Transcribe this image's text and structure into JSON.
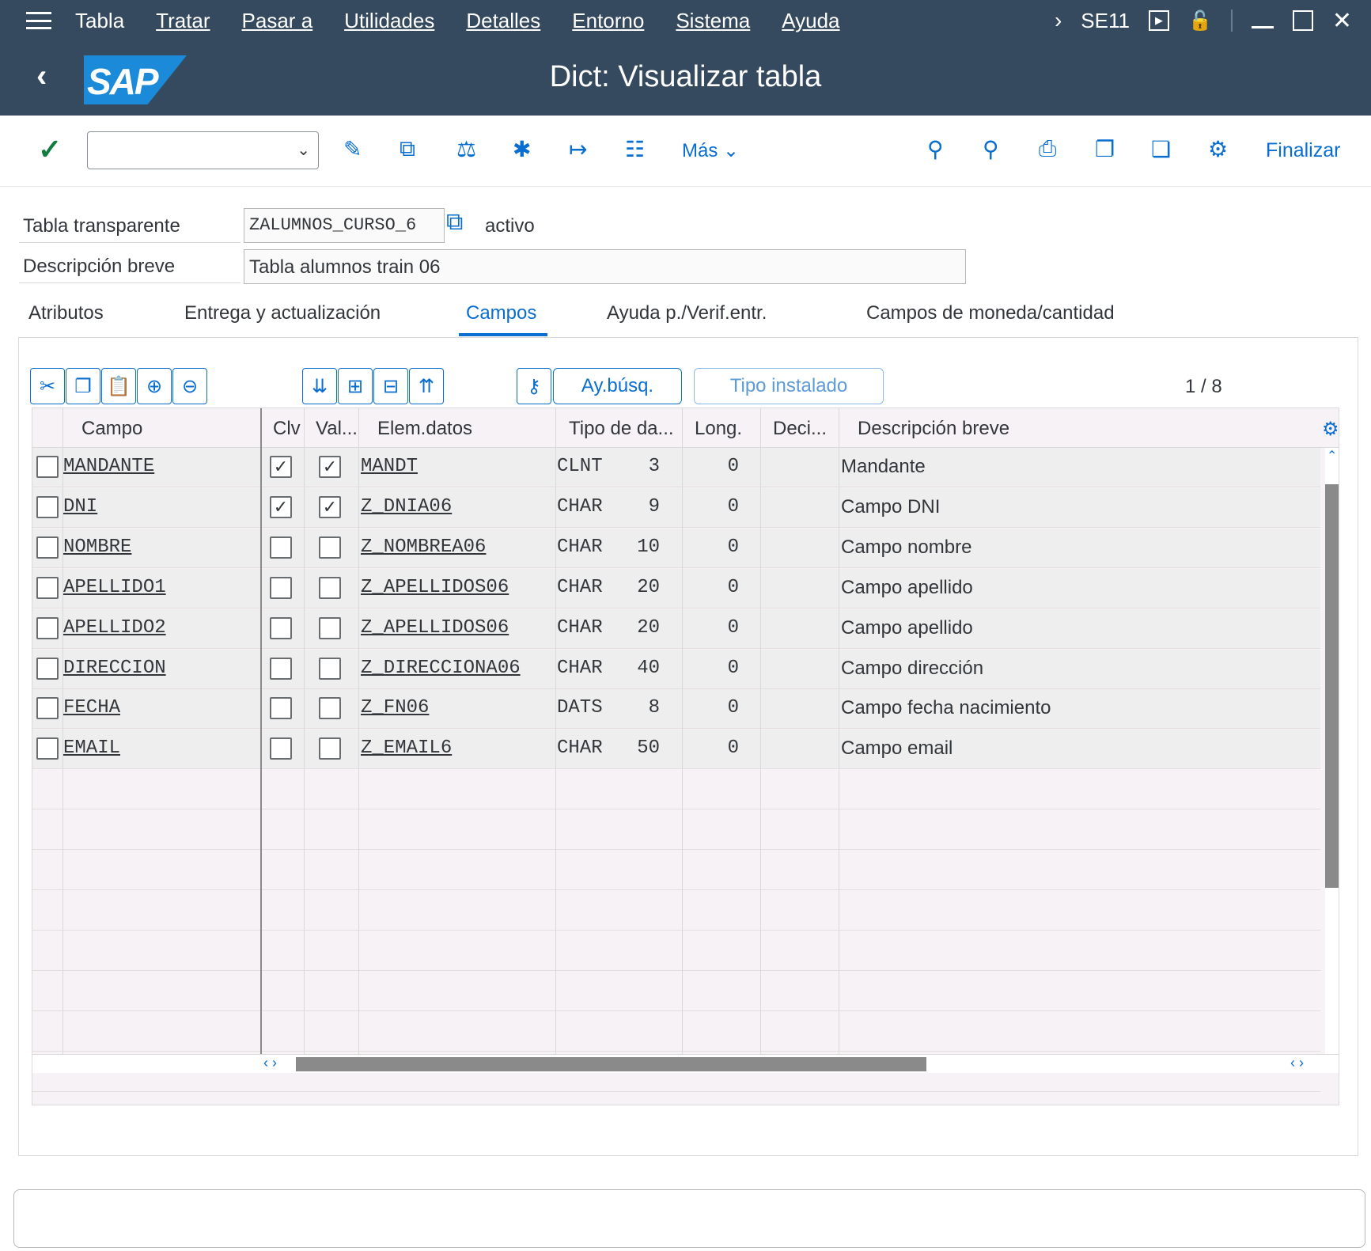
{
  "menu": {
    "items": [
      "Tabla",
      "Tratar",
      "Pasar a",
      "Utilidades",
      "Detalles",
      "Entorno",
      "Sistema",
      "Ayuda"
    ],
    "transaction": "SE11"
  },
  "title": "Dict: Visualizar tabla",
  "logo_text": "SAP",
  "toolbar": {
    "more_label": "Más",
    "finish_label": "Finalizar"
  },
  "header": {
    "table_label": "Tabla transparente",
    "table_value": "ZALUMNOS_CURSO_6",
    "status": "activo",
    "desc_label": "Descripción breve",
    "desc_value": "Tabla alumnos train 06"
  },
  "tabs": [
    "Atributos",
    "Entrega y actualización",
    "Campos",
    "Ayuda p./Verif.entr.",
    "Campos de moneda/cantidad"
  ],
  "active_tab": "Campos",
  "buttons": {
    "search_help": "Ay.búsq.",
    "builtin_type": "Tipo instalado"
  },
  "counter": "1 / 8",
  "columns": [
    "Campo",
    "Clv",
    "Val...",
    "Elem.datos",
    "Tipo de da...",
    "Long.",
    "Deci...",
    "Descripción breve"
  ],
  "rows": [
    {
      "campo": "MANDANTE",
      "clave": true,
      "val": true,
      "elem": "MANDT",
      "tipo": "CLNT",
      "long": "3",
      "deci": "0",
      "desc": "Mandante"
    },
    {
      "campo": "DNI",
      "clave": true,
      "val": true,
      "elem": "Z_DNIA06",
      "tipo": "CHAR",
      "long": "9",
      "deci": "0",
      "desc": "Campo DNI"
    },
    {
      "campo": "NOMBRE",
      "clave": false,
      "val": false,
      "elem": "Z_NOMBREA06",
      "tipo": "CHAR",
      "long": "10",
      "deci": "0",
      "desc": "Campo nombre"
    },
    {
      "campo": "APELLIDO1",
      "clave": false,
      "val": false,
      "elem": "Z_APELLIDOS06",
      "tipo": "CHAR",
      "long": "20",
      "deci": "0",
      "desc": "Campo apellido"
    },
    {
      "campo": "APELLIDO2",
      "clave": false,
      "val": false,
      "elem": "Z_APELLIDOS06",
      "tipo": "CHAR",
      "long": "20",
      "deci": "0",
      "desc": "Campo apellido"
    },
    {
      "campo": "DIRECCION",
      "clave": false,
      "val": false,
      "elem": "Z_DIRECCIONA06",
      "tipo": "CHAR",
      "long": "40",
      "deci": "0",
      "desc": "Campo dirección"
    },
    {
      "campo": "FECHA",
      "clave": false,
      "val": false,
      "elem": "Z_FN06",
      "tipo": "DATS",
      "long": "8",
      "deci": "0",
      "desc": "Campo fecha nacimiento"
    },
    {
      "campo": "EMAIL",
      "clave": false,
      "val": false,
      "elem": "Z_EMAIL6",
      "tipo": "CHAR",
      "long": "50",
      "deci": "0",
      "desc": "Campo email"
    }
  ],
  "colors": {
    "shell": "#354a5f",
    "accent": "#0a6ed1",
    "check": "#107e3e"
  }
}
